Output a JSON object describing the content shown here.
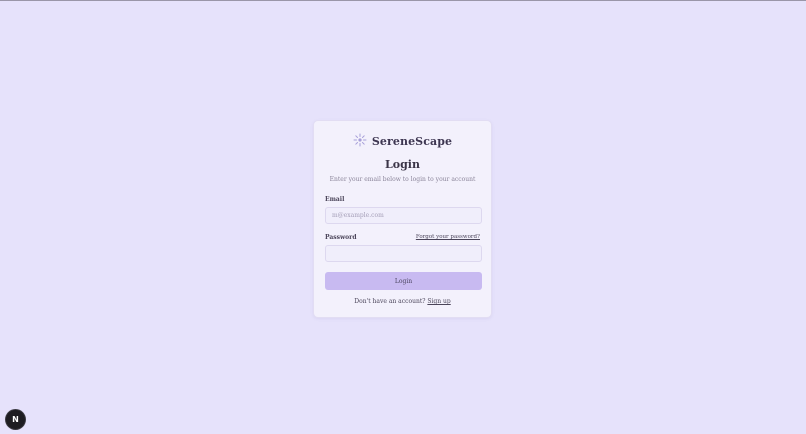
{
  "brand": {
    "name": "SereneScape",
    "logo_icon": "sparkle-icon"
  },
  "form": {
    "title": "Login",
    "subtitle": "Enter your email below to login to your account",
    "email_label": "Email",
    "email_placeholder": "m@example.com",
    "email_value": "",
    "password_label": "Password",
    "password_value": "",
    "forgot_link": "Forgot your password?",
    "login_button": "Login",
    "signup_prompt": "Don't have an account?",
    "signup_link": "Sign up"
  },
  "badge": {
    "letter": "N"
  },
  "colors": {
    "background": "#e6e2fb",
    "card": "#f3f1fc",
    "button": "#c8baf1"
  }
}
